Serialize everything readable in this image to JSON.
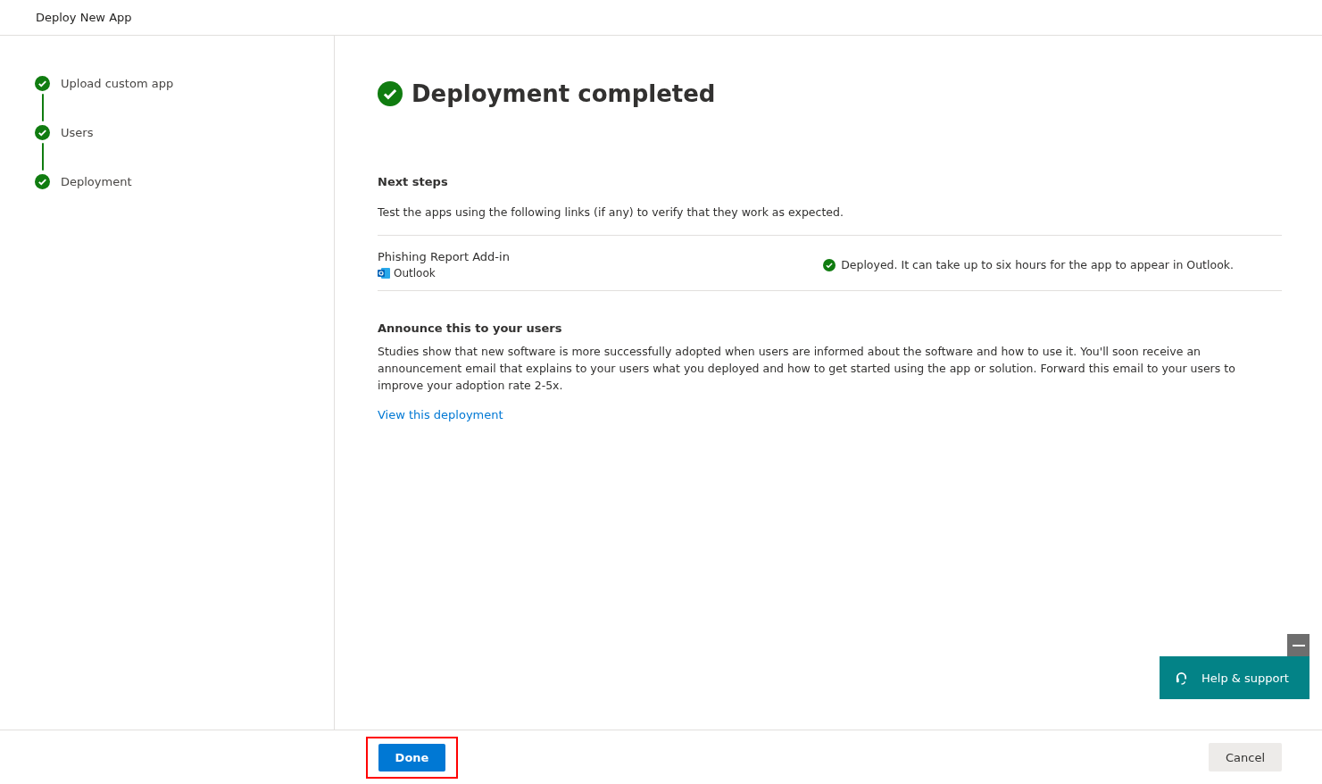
{
  "window": {
    "title": "Deploy New App"
  },
  "steps": [
    {
      "label": "Upload custom app",
      "completed": true
    },
    {
      "label": "Users",
      "completed": true
    },
    {
      "label": "Deployment",
      "completed": true
    }
  ],
  "heading": {
    "title": "Deployment completed",
    "completed": true
  },
  "next_steps": {
    "title": "Next steps",
    "text": "Test the apps using the following links (if any) to verify that they work as expected."
  },
  "apps": [
    {
      "name": "Phishing Report Add-in",
      "host": "Outlook",
      "status": "Deployed. It can take up to six hours for the app to appear in Outlook.",
      "deployed": true
    }
  ],
  "announce": {
    "title": "Announce this to your users",
    "text": "Studies show that new software is more successfully adopted when users are informed about the software and how to use it. You'll soon receive an announcement email that explains to your users what you deployed and how to get started using the app or solution. Forward this email to your users to improve your adoption rate 2-5x.",
    "link": "View this deployment"
  },
  "help": {
    "label": "Help & support"
  },
  "footer": {
    "done": {
      "label": "Done",
      "highlighted": true
    },
    "cancel": {
      "label": "Cancel"
    }
  }
}
